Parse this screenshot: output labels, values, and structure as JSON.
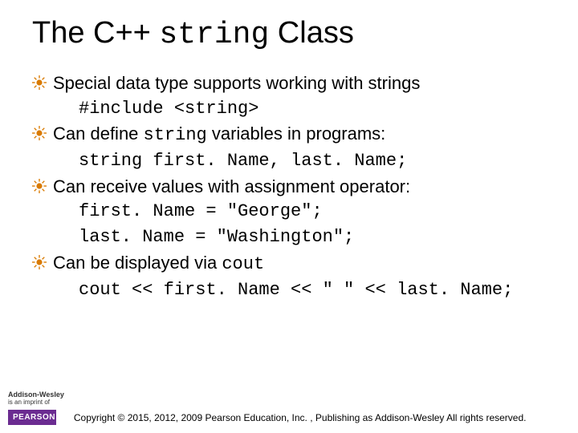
{
  "title": {
    "pre": "The C++ ",
    "code": "string",
    "post": " Class"
  },
  "bullets": [
    {
      "text": "Special data type supports working with strings",
      "code_lines": [
        "#include <string>"
      ]
    },
    {
      "text_parts": [
        "Can define ",
        "string",
        " variables in programs:"
      ],
      "code_lines": [
        "string first. Name, last. Name;"
      ]
    },
    {
      "text": "Can receive values with assignment operator:",
      "code_lines": [
        "first. Name = \"George\";",
        "last. Name = \"Washington\";"
      ]
    },
    {
      "text_parts": [
        "Can be displayed via ",
        "cout",
        ""
      ],
      "code_lines": [
        "cout << first. Name << \" \" << last. Name;"
      ]
    }
  ],
  "footer": {
    "aw_brand": "Addison-Wesley",
    "aw_sub": "is an imprint of",
    "pearson": "PEARSON",
    "copyright": "Copyright © 2015, 2012, 2009 Pearson Education, Inc. , Publishing as Addison-Wesley All rights reserved."
  }
}
